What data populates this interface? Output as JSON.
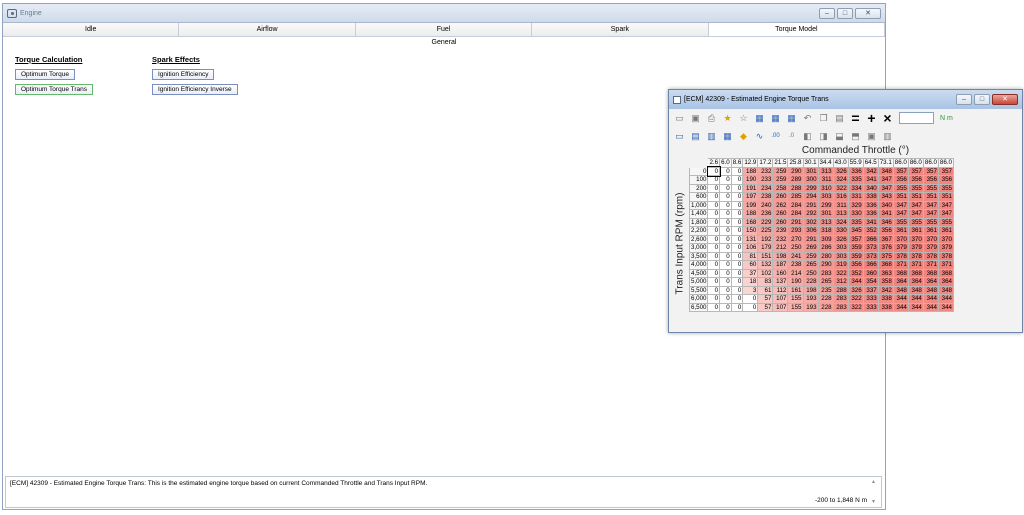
{
  "main_window": {
    "title": "Engine",
    "tabs": [
      "Idle",
      "Airflow",
      "Fuel",
      "Spark",
      "Torque Model"
    ],
    "active_tab": "Torque Model",
    "subheader": "General",
    "groups": [
      {
        "title": "Torque Calculation",
        "buttons": [
          {
            "label": "Optimum Torque",
            "style": "blue"
          },
          {
            "label": "Optimum Torque Trans",
            "style": "green"
          }
        ]
      },
      {
        "title": "Spark Effects",
        "buttons": [
          {
            "label": "Ignition Efficiency",
            "style": "blue"
          },
          {
            "label": "Ignition Efficiency Inverse",
            "style": "blue"
          }
        ]
      }
    ],
    "status": {
      "text": "[ECM] 42309 - Estimated Engine Torque Trans: This is the estimated engine torque based on current Commanded Throttle and Trans Input RPM.",
      "range": "-200 to 1,848 N m"
    }
  },
  "table_window": {
    "title": "[ECM] 42309 - Estimated Engine Torque Trans",
    "unit_label": "N m",
    "x_axis_title": "Commanded Throttle (°)",
    "y_axis_title": "Trans Input RPM (rpm)",
    "columns": [
      "2.6",
      "6.0",
      "8.6",
      "12.9",
      "17.2",
      "21.5",
      "25.8",
      "30.1",
      "34.4",
      "43.0",
      "55.9",
      "64.5",
      "73.1",
      "86.0",
      "86.0",
      "86.0",
      "86.0"
    ],
    "rows": [
      {
        "rpm": "0",
        "values": [
          0,
          0,
          0,
          188,
          232,
          259,
          290,
          301,
          313,
          326,
          336,
          342,
          348,
          357,
          357,
          357,
          357
        ]
      },
      {
        "rpm": "100",
        "values": [
          0,
          0,
          0,
          190,
          233,
          259,
          289,
          300,
          311,
          324,
          335,
          341,
          347,
          356,
          356,
          356,
          356
        ]
      },
      {
        "rpm": "200",
        "values": [
          0,
          0,
          0,
          191,
          234,
          258,
          288,
          299,
          310,
          322,
          334,
          340,
          347,
          355,
          355,
          355,
          355
        ]
      },
      {
        "rpm": "600",
        "values": [
          0,
          0,
          0,
          197,
          238,
          260,
          285,
          294,
          303,
          316,
          331,
          338,
          343,
          351,
          351,
          351,
          351
        ]
      },
      {
        "rpm": "1,000",
        "values": [
          0,
          0,
          0,
          199,
          240,
          262,
          284,
          291,
          299,
          311,
          329,
          336,
          340,
          347,
          347,
          347,
          347
        ]
      },
      {
        "rpm": "1,400",
        "values": [
          0,
          0,
          0,
          188,
          236,
          260,
          284,
          292,
          301,
          313,
          330,
          336,
          341,
          347,
          347,
          347,
          347
        ]
      },
      {
        "rpm": "1,800",
        "values": [
          0,
          0,
          0,
          168,
          229,
          260,
          291,
          302,
          313,
          324,
          335,
          341,
          346,
          355,
          355,
          355,
          355
        ]
      },
      {
        "rpm": "2,200",
        "values": [
          0,
          0,
          0,
          150,
          225,
          239,
          293,
          306,
          318,
          330,
          345,
          352,
          356,
          361,
          361,
          361,
          361
        ]
      },
      {
        "rpm": "2,600",
        "values": [
          0,
          0,
          0,
          131,
          192,
          232,
          270,
          291,
          309,
          326,
          357,
          366,
          367,
          370,
          370,
          370,
          370
        ]
      },
      {
        "rpm": "3,000",
        "values": [
          0,
          0,
          0,
          106,
          179,
          212,
          250,
          269,
          286,
          303,
          359,
          373,
          376,
          379,
          379,
          379,
          379
        ]
      },
      {
        "rpm": "3,500",
        "values": [
          0,
          0,
          0,
          81,
          151,
          198,
          241,
          259,
          280,
          303,
          359,
          373,
          375,
          378,
          378,
          378,
          378
        ]
      },
      {
        "rpm": "4,000",
        "values": [
          0,
          0,
          0,
          60,
          132,
          187,
          238,
          265,
          290,
          319,
          356,
          366,
          368,
          371,
          371,
          371,
          371
        ]
      },
      {
        "rpm": "4,500",
        "values": [
          0,
          0,
          0,
          37,
          102,
          160,
          214,
          250,
          283,
          322,
          352,
          360,
          363,
          368,
          368,
          368,
          368
        ]
      },
      {
        "rpm": "5,000",
        "values": [
          0,
          0,
          0,
          18,
          83,
          137,
          190,
          228,
          265,
          312,
          344,
          354,
          358,
          364,
          364,
          364,
          364
        ]
      },
      {
        "rpm": "5,500",
        "values": [
          0,
          0,
          0,
          3,
          61,
          112,
          161,
          198,
          235,
          288,
          326,
          337,
          342,
          348,
          348,
          348,
          348
        ]
      },
      {
        "rpm": "6,000",
        "values": [
          0,
          0,
          0,
          0,
          57,
          107,
          155,
          193,
          228,
          283,
          322,
          333,
          338,
          344,
          344,
          344,
          344
        ]
      },
      {
        "rpm": "6,500",
        "values": [
          0,
          0,
          0,
          0,
          57,
          107,
          155,
          193,
          228,
          283,
          322,
          333,
          338,
          344,
          344,
          344,
          344
        ]
      }
    ],
    "heat_colors": {
      "low": "#ffffff",
      "mid": "#f7c9c6",
      "high": "#f08b85"
    }
  }
}
